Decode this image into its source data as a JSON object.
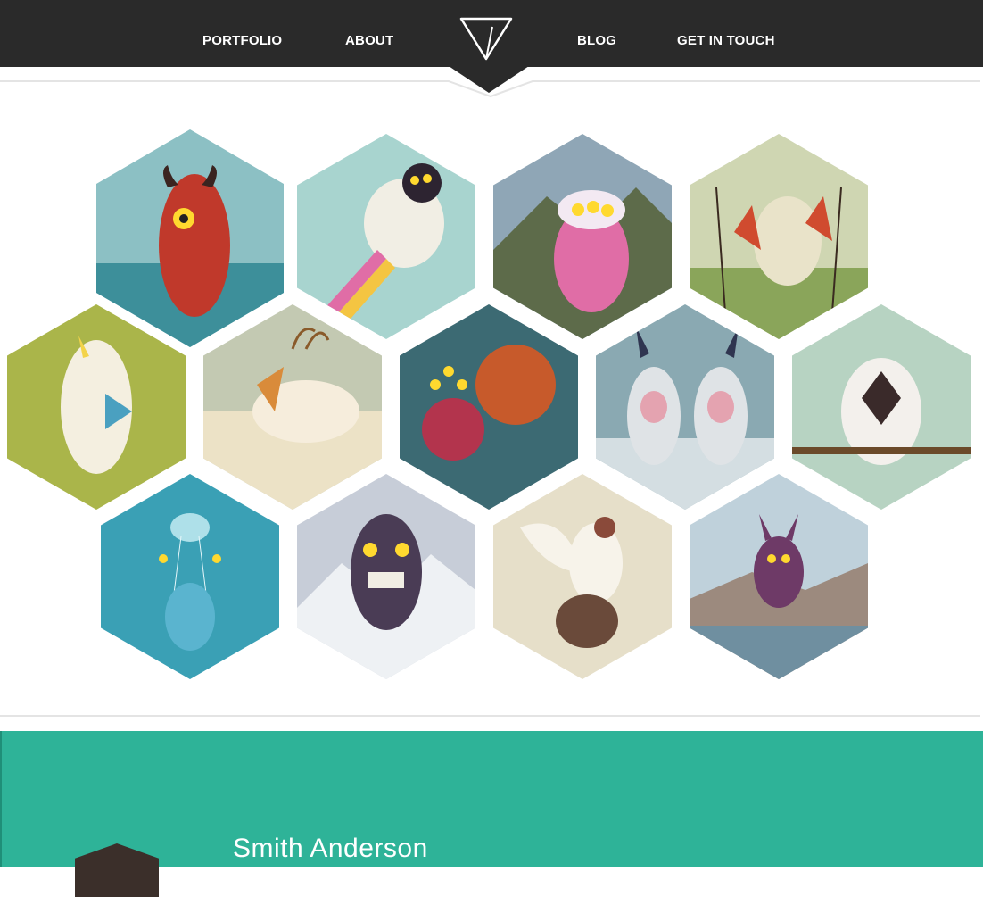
{
  "nav": {
    "items": [
      "PORTFOLIO",
      "ABOUT",
      "BLOG",
      "GET IN TOUCH"
    ],
    "logo_icon": "triangle-logo-icon"
  },
  "colors": {
    "header_bg": "#2a2a2a",
    "teal": "#2eb398",
    "divider": "#e4e4e4"
  },
  "gallery": {
    "items": [
      {
        "subject": "red horned monster",
        "bg": "#8cc0c4",
        "fg": "#c0392b"
      },
      {
        "subject": "flying sheep with rainbow",
        "bg": "#a8d4cf",
        "fg": "#f1eee4"
      },
      {
        "subject": "pink cow with many eyes",
        "bg": "#5d6b4a",
        "fg": "#e06da6"
      },
      {
        "subject": "creature with red birds",
        "bg": "#bcc99a",
        "fg": "#e9e3c9"
      },
      {
        "subject": "sleeping unicorn creature",
        "bg": "#aab54a",
        "fg": "#f4efe0"
      },
      {
        "subject": "white deer with pyramid",
        "bg": "#d9d0a8",
        "fg": "#f6eddc"
      },
      {
        "subject": "octopus sea monster",
        "bg": "#3c6a73",
        "fg": "#c75a2b"
      },
      {
        "subject": "two yetis in snow",
        "bg": "#8aa9b2",
        "fg": "#dfe3e6"
      },
      {
        "subject": "furry creature on branch",
        "bg": "#b7d3c2",
        "fg": "#f3f0ec"
      },
      {
        "subject": "jellyfish underwater",
        "bg": "#3aa0b5",
        "fg": "#aee0e9"
      },
      {
        "subject": "tiki mask monster",
        "bg": "#c7cdd8",
        "fg": "#4a3c55"
      },
      {
        "subject": "bird carrying creature",
        "bg": "#e6dfc9",
        "fg": "#f7f3ea"
      },
      {
        "subject": "purple horned monster over lake",
        "bg": "#9c8a7e",
        "fg": "#6e3a67"
      }
    ]
  },
  "author": {
    "name": "Smith Anderson"
  }
}
